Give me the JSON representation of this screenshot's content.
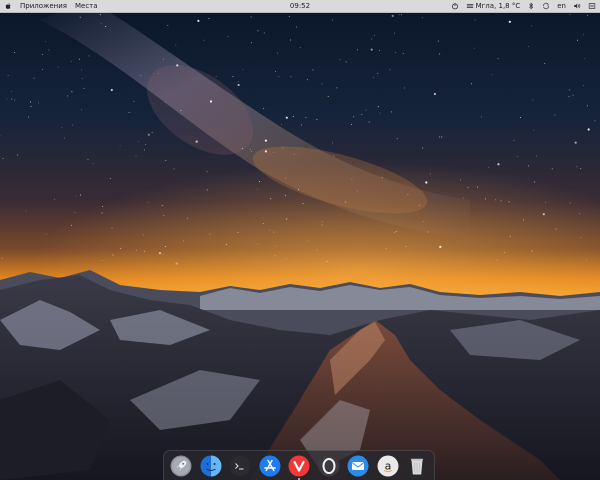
{
  "topbar": {
    "menus": [
      {
        "label": "Приложения"
      },
      {
        "label": "Места"
      }
    ],
    "clock": "09:52",
    "weather": "Мгла, 1,8 °C",
    "keyboard_layout": "en"
  },
  "dock": {
    "apps": [
      {
        "name": "launchpad-rocket",
        "running": false
      },
      {
        "name": "finder-face",
        "running": false
      },
      {
        "name": "terminal",
        "running": false
      },
      {
        "name": "app-store",
        "running": false
      },
      {
        "name": "vivaldi-browser",
        "running": true
      },
      {
        "name": "opera-browser",
        "running": false
      },
      {
        "name": "mail-envelope",
        "running": false
      },
      {
        "name": "amazon",
        "running": false
      },
      {
        "name": "trash",
        "running": false
      }
    ]
  },
  "colors": {
    "panel_bg": "#ebebeb",
    "dock_bg": "#28282d",
    "app_store_blue": "#1e7cf2",
    "vivaldi_red": "#ef3939",
    "mail_blue": "#2a8be8"
  }
}
